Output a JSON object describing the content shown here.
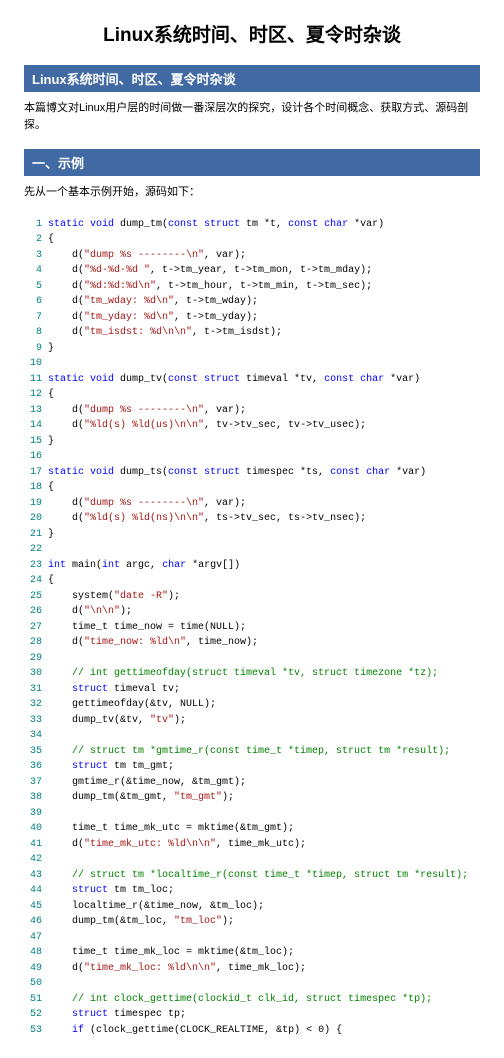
{
  "title": "Linux系统时间、时区、夏令时杂谈",
  "section1_title": "Linux系统时间、时区、夏令时杂谈",
  "intro": "本篇博文对Linux用户层的时间做一番深层次的探究，设计各个时间概念、获取方式、源码剖探。",
  "section2_title": "一、示例",
  "example_intro": "先从一个基本示例开始，源码如下：",
  "code": [
    {
      "n": 1,
      "t": [
        {
          "c": "kw",
          "v": "static void"
        },
        {
          "c": "plain",
          "v": " dump_tm("
        },
        {
          "c": "kw",
          "v": "const struct"
        },
        {
          "c": "plain",
          "v": " tm *t, "
        },
        {
          "c": "kw",
          "v": "const char"
        },
        {
          "c": "plain",
          "v": " *var)"
        }
      ]
    },
    {
      "n": 2,
      "t": [
        {
          "c": "plain",
          "v": "{"
        }
      ]
    },
    {
      "n": 3,
      "t": [
        {
          "c": "plain",
          "v": "    d("
        },
        {
          "c": "str",
          "v": "\"dump %s --------\\n\""
        },
        {
          "c": "plain",
          "v": ", var);"
        }
      ]
    },
    {
      "n": 4,
      "t": [
        {
          "c": "plain",
          "v": "    d("
        },
        {
          "c": "str",
          "v": "\"%d-%d-%d \""
        },
        {
          "c": "plain",
          "v": ", t->tm_year, t->tm_mon, t->tm_mday);"
        }
      ]
    },
    {
      "n": 5,
      "t": [
        {
          "c": "plain",
          "v": "    d("
        },
        {
          "c": "str",
          "v": "\"%d:%d:%d\\n\""
        },
        {
          "c": "plain",
          "v": ", t->tm_hour, t->tm_min, t->tm_sec);"
        }
      ]
    },
    {
      "n": 6,
      "t": [
        {
          "c": "plain",
          "v": "    d("
        },
        {
          "c": "str",
          "v": "\"tm_wday: %d\\n\""
        },
        {
          "c": "plain",
          "v": ", t->tm_wday);"
        }
      ]
    },
    {
      "n": 7,
      "t": [
        {
          "c": "plain",
          "v": "    d("
        },
        {
          "c": "str",
          "v": "\"tm_yday: %d\\n\""
        },
        {
          "c": "plain",
          "v": ", t->tm_yday);"
        }
      ]
    },
    {
      "n": 8,
      "t": [
        {
          "c": "plain",
          "v": "    d("
        },
        {
          "c": "str",
          "v": "\"tm_isdst: %d\\n\\n\""
        },
        {
          "c": "plain",
          "v": ", t->tm_isdst);"
        }
      ]
    },
    {
      "n": 9,
      "t": [
        {
          "c": "plain",
          "v": "}"
        }
      ]
    },
    {
      "n": 10,
      "t": []
    },
    {
      "n": 11,
      "t": [
        {
          "c": "kw",
          "v": "static void"
        },
        {
          "c": "plain",
          "v": " dump_tv("
        },
        {
          "c": "kw",
          "v": "const struct"
        },
        {
          "c": "plain",
          "v": " timeval *tv, "
        },
        {
          "c": "kw",
          "v": "const char"
        },
        {
          "c": "plain",
          "v": " *var)"
        }
      ]
    },
    {
      "n": 12,
      "t": [
        {
          "c": "plain",
          "v": "{"
        }
      ]
    },
    {
      "n": 13,
      "t": [
        {
          "c": "plain",
          "v": "    d("
        },
        {
          "c": "str",
          "v": "\"dump %s --------\\n\""
        },
        {
          "c": "plain",
          "v": ", var);"
        }
      ]
    },
    {
      "n": 14,
      "t": [
        {
          "c": "plain",
          "v": "    d("
        },
        {
          "c": "str",
          "v": "\"%ld(s) %ld(us)\\n\\n\""
        },
        {
          "c": "plain",
          "v": ", tv->tv_sec, tv->tv_usec);"
        }
      ]
    },
    {
      "n": 15,
      "t": [
        {
          "c": "plain",
          "v": "}"
        }
      ]
    },
    {
      "n": 16,
      "t": []
    },
    {
      "n": 17,
      "t": [
        {
          "c": "kw",
          "v": "static void"
        },
        {
          "c": "plain",
          "v": " dump_ts("
        },
        {
          "c": "kw",
          "v": "const struct"
        },
        {
          "c": "plain",
          "v": " timespec *ts, "
        },
        {
          "c": "kw",
          "v": "const char"
        },
        {
          "c": "plain",
          "v": " *var)"
        }
      ]
    },
    {
      "n": 18,
      "t": [
        {
          "c": "plain",
          "v": "{"
        }
      ]
    },
    {
      "n": 19,
      "t": [
        {
          "c": "plain",
          "v": "    d("
        },
        {
          "c": "str",
          "v": "\"dump %s --------\\n\""
        },
        {
          "c": "plain",
          "v": ", var);"
        }
      ]
    },
    {
      "n": 20,
      "t": [
        {
          "c": "plain",
          "v": "    d("
        },
        {
          "c": "str",
          "v": "\"%ld(s) %ld(ns)\\n\\n\""
        },
        {
          "c": "plain",
          "v": ", ts->tv_sec, ts->tv_nsec);"
        }
      ]
    },
    {
      "n": 21,
      "t": [
        {
          "c": "plain",
          "v": "}"
        }
      ]
    },
    {
      "n": 22,
      "t": []
    },
    {
      "n": 23,
      "t": [
        {
          "c": "kw",
          "v": "int"
        },
        {
          "c": "plain",
          "v": " main("
        },
        {
          "c": "kw",
          "v": "int"
        },
        {
          "c": "plain",
          "v": " argc, "
        },
        {
          "c": "kw",
          "v": "char"
        },
        {
          "c": "plain",
          "v": " *argv[])"
        }
      ]
    },
    {
      "n": 24,
      "t": [
        {
          "c": "plain",
          "v": "{"
        }
      ]
    },
    {
      "n": 25,
      "t": [
        {
          "c": "plain",
          "v": "    system("
        },
        {
          "c": "str",
          "v": "\"date -R\""
        },
        {
          "c": "plain",
          "v": ");"
        }
      ]
    },
    {
      "n": 26,
      "t": [
        {
          "c": "plain",
          "v": "    d("
        },
        {
          "c": "str",
          "v": "\"\\n\\n\""
        },
        {
          "c": "plain",
          "v": ");"
        }
      ]
    },
    {
      "n": 27,
      "t": [
        {
          "c": "plain",
          "v": "    time_t time_now = time(NULL);"
        }
      ]
    },
    {
      "n": 28,
      "t": [
        {
          "c": "plain",
          "v": "    d("
        },
        {
          "c": "str",
          "v": "\"time_now: %ld\\n\""
        },
        {
          "c": "plain",
          "v": ", time_now);"
        }
      ]
    },
    {
      "n": 29,
      "t": []
    },
    {
      "n": 30,
      "t": [
        {
          "c": "plain",
          "v": "    "
        },
        {
          "c": "cmt",
          "v": "// int gettimeofday(struct timeval *tv, struct timezone *tz);"
        }
      ]
    },
    {
      "n": 31,
      "t": [
        {
          "c": "plain",
          "v": "    "
        },
        {
          "c": "kw",
          "v": "struct"
        },
        {
          "c": "plain",
          "v": " timeval tv;"
        }
      ]
    },
    {
      "n": 32,
      "t": [
        {
          "c": "plain",
          "v": "    gettimeofday(&tv, NULL);"
        }
      ]
    },
    {
      "n": 33,
      "t": [
        {
          "c": "plain",
          "v": "    dump_tv(&tv, "
        },
        {
          "c": "str",
          "v": "\"tv\""
        },
        {
          "c": "plain",
          "v": ");"
        }
      ]
    },
    {
      "n": 34,
      "t": []
    },
    {
      "n": 35,
      "t": [
        {
          "c": "plain",
          "v": "    "
        },
        {
          "c": "cmt",
          "v": "// struct tm *gmtime_r(const time_t *timep, struct tm *result);"
        }
      ]
    },
    {
      "n": 36,
      "t": [
        {
          "c": "plain",
          "v": "    "
        },
        {
          "c": "kw",
          "v": "struct"
        },
        {
          "c": "plain",
          "v": " tm tm_gmt;"
        }
      ]
    },
    {
      "n": 37,
      "t": [
        {
          "c": "plain",
          "v": "    gmtime_r(&time_now, &tm_gmt);"
        }
      ]
    },
    {
      "n": 38,
      "t": [
        {
          "c": "plain",
          "v": "    dump_tm(&tm_gmt, "
        },
        {
          "c": "str",
          "v": "\"tm_gmt\""
        },
        {
          "c": "plain",
          "v": ");"
        }
      ]
    },
    {
      "n": 39,
      "t": []
    },
    {
      "n": 40,
      "t": [
        {
          "c": "plain",
          "v": "    time_t time_mk_utc = mktime(&tm_gmt);"
        }
      ]
    },
    {
      "n": 41,
      "t": [
        {
          "c": "plain",
          "v": "    d("
        },
        {
          "c": "str",
          "v": "\"time_mk_utc: %ld\\n\\n\""
        },
        {
          "c": "plain",
          "v": ", time_mk_utc);"
        }
      ]
    },
    {
      "n": 42,
      "t": []
    },
    {
      "n": 43,
      "t": [
        {
          "c": "plain",
          "v": "    "
        },
        {
          "c": "cmt",
          "v": "// struct tm *localtime_r(const time_t *timep, struct tm *result);"
        }
      ]
    },
    {
      "n": 44,
      "t": [
        {
          "c": "plain",
          "v": "    "
        },
        {
          "c": "kw",
          "v": "struct"
        },
        {
          "c": "plain",
          "v": " tm tm_loc;"
        }
      ]
    },
    {
      "n": 45,
      "t": [
        {
          "c": "plain",
          "v": "    localtime_r(&time_now, &tm_loc);"
        }
      ]
    },
    {
      "n": 46,
      "t": [
        {
          "c": "plain",
          "v": "    dump_tm(&tm_loc, "
        },
        {
          "c": "str",
          "v": "\"tm_loc\""
        },
        {
          "c": "plain",
          "v": ");"
        }
      ]
    },
    {
      "n": 47,
      "t": []
    },
    {
      "n": 48,
      "t": [
        {
          "c": "plain",
          "v": "    time_t time_mk_loc = mktime(&tm_loc);"
        }
      ]
    },
    {
      "n": 49,
      "t": [
        {
          "c": "plain",
          "v": "    d("
        },
        {
          "c": "str",
          "v": "\"time_mk_loc: %ld\\n\\n\""
        },
        {
          "c": "plain",
          "v": ", time_mk_loc);"
        }
      ]
    },
    {
      "n": 50,
      "t": []
    },
    {
      "n": 51,
      "t": [
        {
          "c": "plain",
          "v": "    "
        },
        {
          "c": "cmt",
          "v": "// int clock_gettime(clockid_t clk_id, struct timespec *tp);"
        }
      ]
    },
    {
      "n": 52,
      "t": [
        {
          "c": "plain",
          "v": "    "
        },
        {
          "c": "kw",
          "v": "struct"
        },
        {
          "c": "plain",
          "v": " timespec tp;"
        }
      ]
    },
    {
      "n": 53,
      "t": [
        {
          "c": "plain",
          "v": "    "
        },
        {
          "c": "kw",
          "v": "if"
        },
        {
          "c": "plain",
          "v": " (clock_gettime(CLOCK_REALTIME, &tp) < "
        },
        {
          "c": "num",
          "v": "0"
        },
        {
          "c": "plain",
          "v": ") {"
        }
      ]
    }
  ]
}
